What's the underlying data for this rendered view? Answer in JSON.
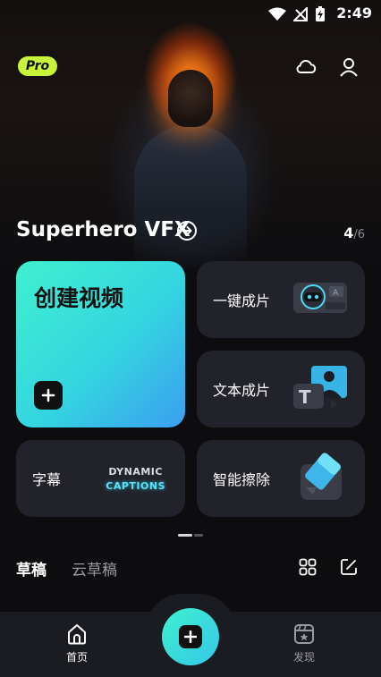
{
  "status_bar": {
    "time": "2:49"
  },
  "header": {
    "pro_badge": "Pro",
    "cloud_icon": "cloud-icon",
    "profile_icon": "user-icon"
  },
  "hero": {
    "title": "Superhero VFX",
    "current": "4",
    "total": "/6"
  },
  "cards": {
    "create": {
      "label": "创建视频"
    },
    "one_click": {
      "label": "一键成片"
    },
    "text_to_video": {
      "label": "文本成片"
    },
    "subtitles": {
      "label": "字幕",
      "art_line1": "DYNAMIC",
      "art_line2": "CAPTIONS"
    },
    "smart_erase": {
      "label": "智能擦除"
    }
  },
  "drafts": {
    "tab_drafts": "草稿",
    "tab_cloud_drafts": "云草稿"
  },
  "bottom_nav": {
    "home_label": "首页",
    "discover_label": "发现"
  },
  "colors": {
    "accent_start": "#3ff0cf",
    "accent_end": "#3b9ef0",
    "pro_badge": "#c8f53a",
    "card_bg": "#22232a"
  }
}
